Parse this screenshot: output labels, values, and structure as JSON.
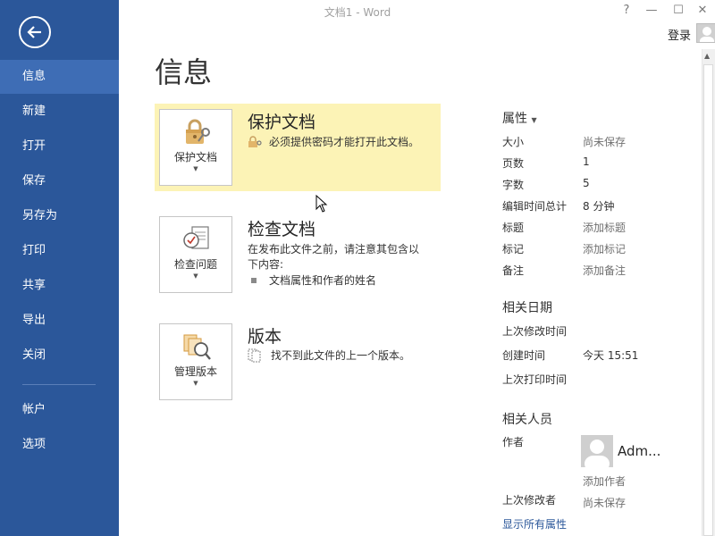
{
  "window": {
    "title": "文档1 - Word",
    "help": "?",
    "minimize": "—",
    "maximize": "☐",
    "close": "✕",
    "login": "登录"
  },
  "sidebar": {
    "items": [
      {
        "label": "信息",
        "active": true
      },
      {
        "label": "新建"
      },
      {
        "label": "打开"
      },
      {
        "label": "保存"
      },
      {
        "label": "另存为"
      },
      {
        "label": "打印"
      },
      {
        "label": "共享"
      },
      {
        "label": "导出"
      },
      {
        "label": "关闭"
      },
      {
        "label": "帐户"
      },
      {
        "label": "选项"
      }
    ]
  },
  "main": {
    "title": "信息",
    "protect": {
      "button_label": "保护文档",
      "title": "保护文档",
      "text": "必须提供密码才能打开此文档。"
    },
    "inspect": {
      "button_label": "检查问题",
      "title": "检查文档",
      "text_line1": "在发布此文件之前，请注意其包含以",
      "text_line2": "下内容:",
      "bullet": "文档属性和作者的姓名"
    },
    "versions": {
      "button_label": "管理版本",
      "title": "版本",
      "text": "找不到此文件的上一个版本。"
    }
  },
  "properties": {
    "header": "属性",
    "rows": [
      {
        "label": "大小",
        "value": "尚未保存",
        "muted": true
      },
      {
        "label": "页数",
        "value": "1"
      },
      {
        "label": "字数",
        "value": "5"
      },
      {
        "label": "编辑时间总计",
        "value": "8 分钟"
      },
      {
        "label": "标题",
        "value": "添加标题",
        "muted": true
      },
      {
        "label": "标记",
        "value": "添加标记",
        "muted": true
      },
      {
        "label": "备注",
        "value": "添加备注",
        "muted": true
      }
    ],
    "dates": {
      "title": "相关日期",
      "last_modified_label": "上次修改时间",
      "created_label": "创建时间",
      "created_value": "今天 15:51",
      "last_printed_label": "上次打印时间"
    },
    "people": {
      "title": "相关人员",
      "author_label": "作者",
      "author_name": "Adm...",
      "add_author": "添加作者",
      "last_modified_by_label": "上次修改者",
      "last_modified_by_value": "尚未保存"
    },
    "show_all": "显示所有属性"
  },
  "colors": {
    "sidebar": "#2b579a",
    "sidebar_active": "#3e6db5",
    "highlight": "#fcf3b6",
    "link": "#2b579a"
  }
}
